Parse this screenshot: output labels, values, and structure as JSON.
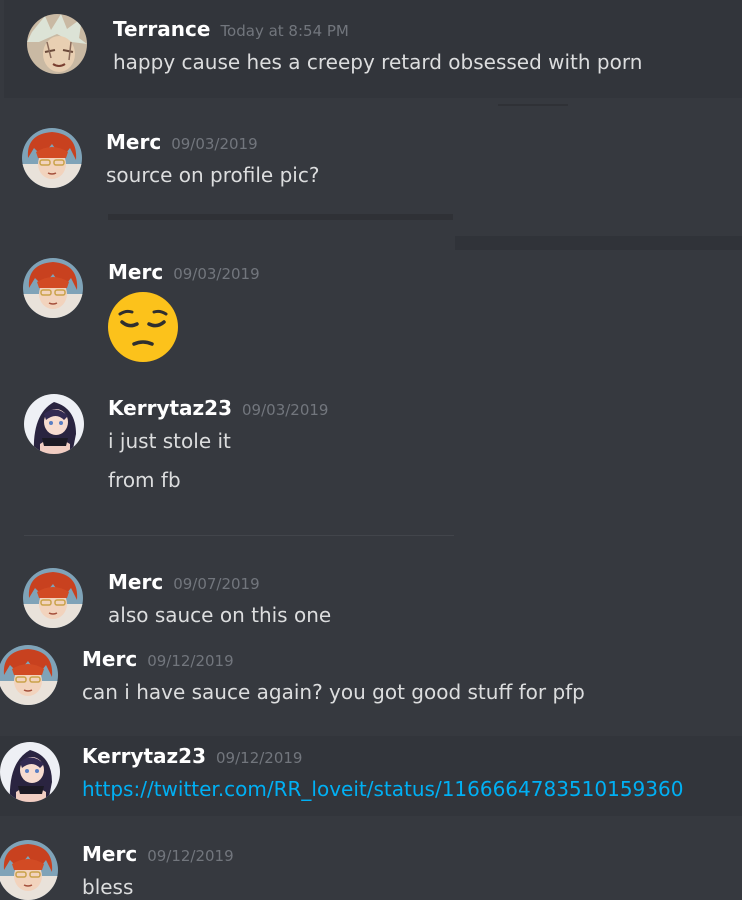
{
  "messages": [
    {
      "username": "Terrance",
      "timestamp": "Today at 8:54 PM",
      "avatar": "terrance-avatar",
      "lines": [
        "happy cause hes a creepy retard obsessed with porn"
      ]
    },
    {
      "username": "Merc",
      "timestamp": "09/03/2019",
      "avatar": "merc-avatar",
      "lines": [
        "source on profile pic?"
      ]
    },
    {
      "username": "Merc",
      "timestamp": "09/03/2019",
      "avatar": "merc-avatar",
      "emoji": "pensive-face-emoji"
    },
    {
      "username": "Kerrytaz23",
      "timestamp": "09/03/2019",
      "avatar": "kerrytaz-avatar",
      "lines": [
        "i just stole it",
        "from fb"
      ]
    },
    {
      "username": "Merc",
      "timestamp": "09/07/2019",
      "avatar": "merc-avatar",
      "lines": [
        "also sauce on this one"
      ]
    },
    {
      "username": "Merc",
      "timestamp": "09/12/2019",
      "avatar": "merc-avatar",
      "lines": [
        "can i have sauce again? you got good stuff for pfp"
      ]
    },
    {
      "username": "Kerrytaz23",
      "timestamp": "09/12/2019",
      "avatar": "kerrytaz-avatar",
      "link": "https://twitter.com/RR_loveit/status/1166664783510159360"
    },
    {
      "username": "Merc",
      "timestamp": "09/12/2019",
      "avatar": "merc-avatar",
      "lines": [
        "bless"
      ]
    }
  ],
  "colors": {
    "background": "#36393f",
    "username": "#ffffff",
    "timestamp": "#72767d",
    "text": "#dcddde",
    "link": "#00b0f4"
  }
}
